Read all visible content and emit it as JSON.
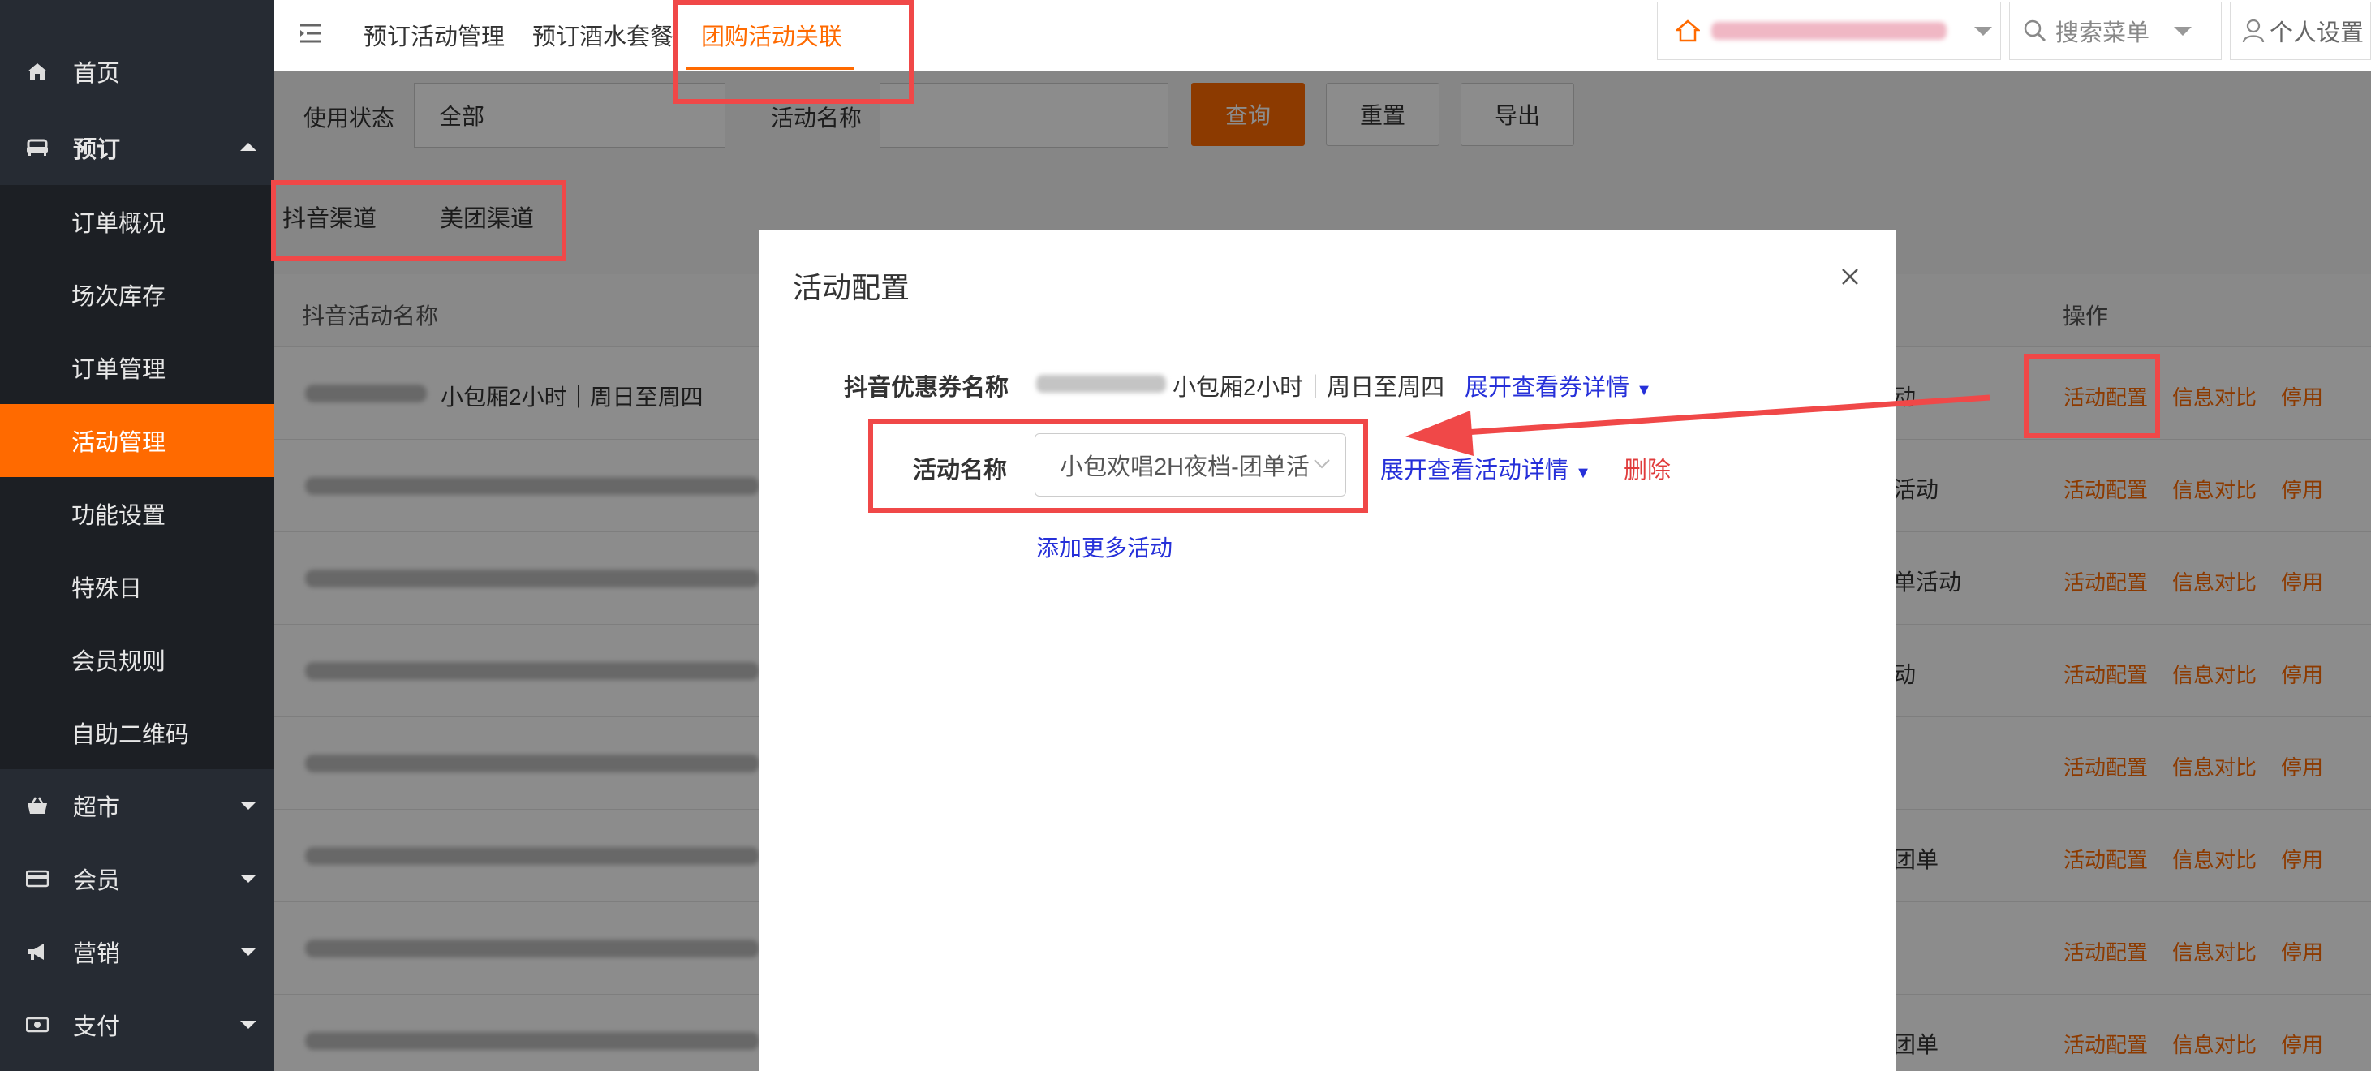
{
  "sidebar": {
    "items": [
      {
        "label": "首页",
        "icon": "home-icon"
      },
      {
        "label": "预订",
        "icon": "sofa-icon"
      },
      {
        "label": "超市",
        "icon": "basket-icon"
      },
      {
        "label": "会员",
        "icon": "card-icon"
      },
      {
        "label": "营销",
        "icon": "megaphone-icon"
      },
      {
        "label": "支付",
        "icon": "money-icon"
      }
    ],
    "sub_items": [
      "订单概况",
      "场次库存",
      "订单管理",
      "活动管理",
      "功能设置",
      "特殊日",
      "会员规则",
      "自助二维码"
    ]
  },
  "topbar": {
    "tabs": [
      "预订活动管理",
      "预订酒水套餐",
      "团购活动关联"
    ],
    "search_menu": "搜索菜单",
    "personal": "个人设置"
  },
  "filters": {
    "status_label": "使用状态",
    "status_value": "全部",
    "name_label": "活动名称",
    "query": "查询",
    "reset": "重置",
    "export": "导出"
  },
  "channels": [
    "抖音渠道",
    "美团渠道"
  ],
  "table": {
    "col_name": "抖音活动名称",
    "col_ops": "操作",
    "first_row_name": "小包厢2小时｜周日至周四",
    "row_types": [
      "动",
      "活动",
      "单活动",
      "动",
      "",
      "团单",
      "",
      "团单"
    ],
    "ops": [
      "活动配置",
      "信息对比",
      "停用"
    ]
  },
  "modal": {
    "title": "活动配置",
    "coupon_label": "抖音优惠券名称",
    "coupon_value": "小包厢2小时｜周日至周四",
    "coupon_link": "展开查看券详情",
    "activity_label": "活动名称",
    "activity_value": "小包欢唱2H夜档-团单活",
    "activity_link": "展开查看活动详情",
    "delete": "删除",
    "add_more": "添加更多活动"
  }
}
